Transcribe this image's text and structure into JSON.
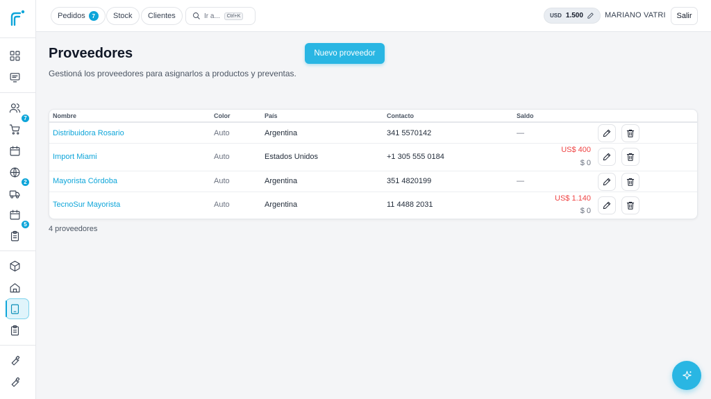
{
  "colors": {
    "accent": "#29b6e3",
    "badge": "#0ea5d9",
    "link": "#0ea5d9",
    "negative": "#ef4444"
  },
  "sidebar": {
    "badges": {
      "cart": "7",
      "truck": "2",
      "clipboard": "5"
    },
    "icons": [
      "dashboard-icon",
      "message-icon",
      "users-icon",
      "cart-icon",
      "calendar-icon",
      "globe-icon",
      "truck-icon",
      "calendar-icon",
      "clipboard-icon",
      "box-icon",
      "home-icon",
      "tablet-icon",
      "clipboard-icon",
      "wrench-icon",
      "wrench-icon"
    ]
  },
  "topbar": {
    "pedidos": "Pedidos",
    "pedidos_badge": "7",
    "stock": "Stock",
    "clientes": "Clientes",
    "search_placeholder": "Ir a...",
    "search_shortcut": "Ctrl+K",
    "currency": "USD",
    "rate": "1.500",
    "user": "MARIANO VATRI",
    "logout": "Salir"
  },
  "page": {
    "title": "Proveedores",
    "subtitle": "Gestioná los proveedores para asignarlos a productos y preventas.",
    "new_button": "Nuevo proveedor",
    "count": "4 proveedores"
  },
  "table": {
    "headers": {
      "name": "Nombre",
      "color": "Color",
      "country": "País",
      "contact": "Contacto",
      "balance": "Saldo"
    },
    "rows": [
      {
        "name": "Distribuidora Rosario",
        "color": "Auto",
        "country": "Argentina",
        "contact": "341 5570142",
        "balance_dash": "—"
      },
      {
        "name": "Import Miami",
        "color": "Auto",
        "country": "Estados Unidos",
        "contact": "+1 305 555 0184",
        "balance_usd": "US$ 400",
        "balance_ars": "$ 0"
      },
      {
        "name": "Mayorista Córdoba",
        "color": "Auto",
        "country": "Argentina",
        "contact": "351 4820199",
        "balance_dash": "—"
      },
      {
        "name": "TecnoSur Mayorista",
        "color": "Auto",
        "country": "Argentina",
        "contact": "11 4488 2031",
        "balance_usd": "US$ 1.140",
        "balance_ars": "$ 0"
      }
    ]
  }
}
